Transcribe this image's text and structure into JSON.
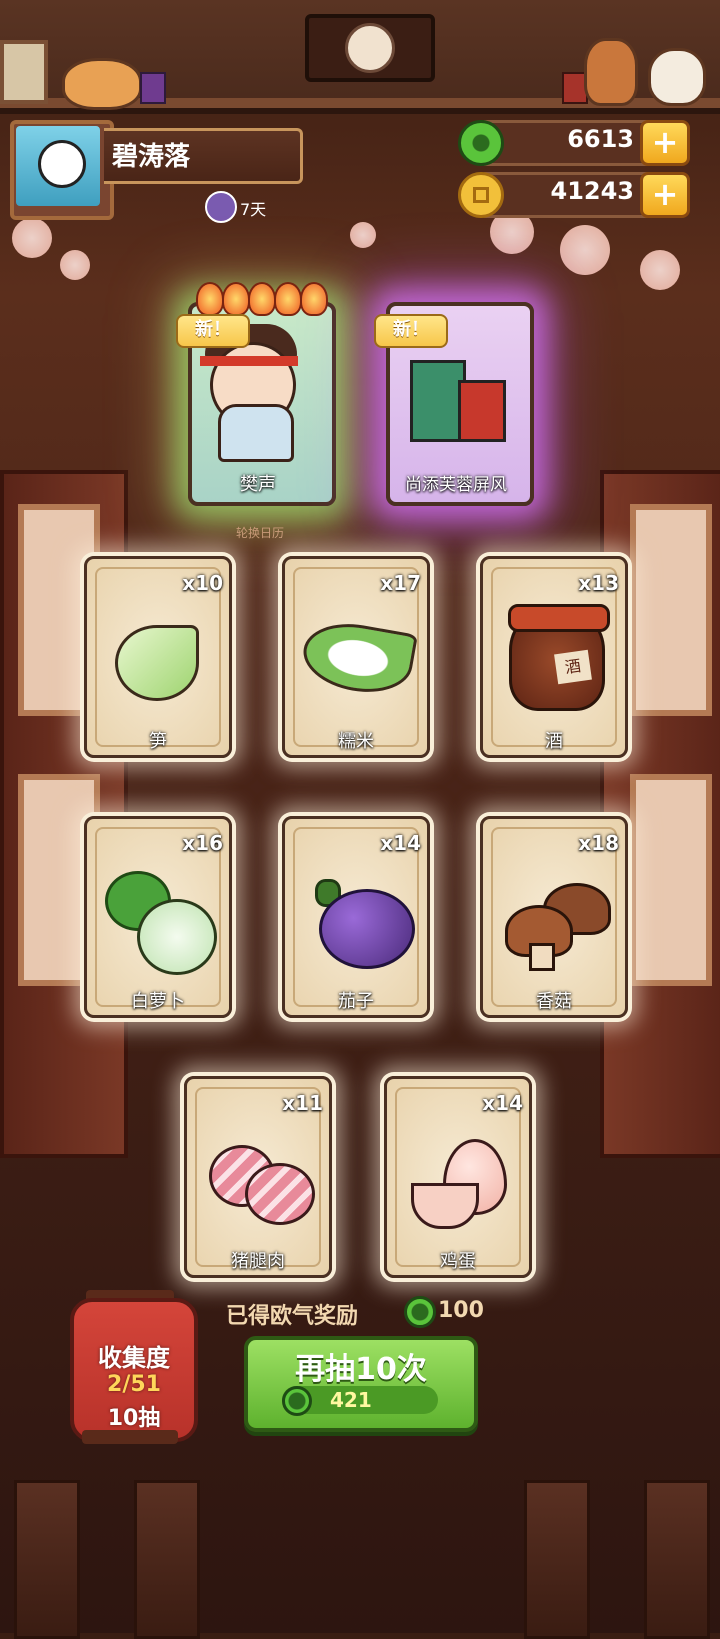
{
  "player": {
    "name": "碧涛落",
    "vip_days": "7天"
  },
  "currencies": [
    {
      "icon": "jade-icon",
      "value": "6613"
    },
    {
      "icon": "coin-icon",
      "value": "41243"
    }
  ],
  "featured": [
    {
      "tag": "新！",
      "name": "樊声",
      "flames": 5
    },
    {
      "tag": "新！",
      "name": "尚添芙蓉屏风"
    }
  ],
  "calendar_label": "轮换日历",
  "items": [
    {
      "name": "笋",
      "qty": "x10"
    },
    {
      "name": "糯米",
      "qty": "x17"
    },
    {
      "name": "酒",
      "qty": "x13",
      "jar_label": "酒"
    },
    {
      "name": "白萝卜",
      "qty": "x16"
    },
    {
      "name": "茄子",
      "qty": "x14"
    },
    {
      "name": "香菇",
      "qty": "x18"
    },
    {
      "name": "猪腿肉",
      "qty": "x11"
    },
    {
      "name": "鸡蛋",
      "qty": "x14"
    }
  ],
  "reward": {
    "label": "已得欧气奖励",
    "value": "100"
  },
  "draw_button": {
    "label": "再抽10次",
    "cost": "421"
  },
  "collection": {
    "title": "收集度",
    "progress": "2/51",
    "draws": "10抽"
  },
  "colors": {
    "draw_green": "#5eb22e",
    "lantern_red": "#c23a2f",
    "plus_gold": "#f0a81e"
  }
}
